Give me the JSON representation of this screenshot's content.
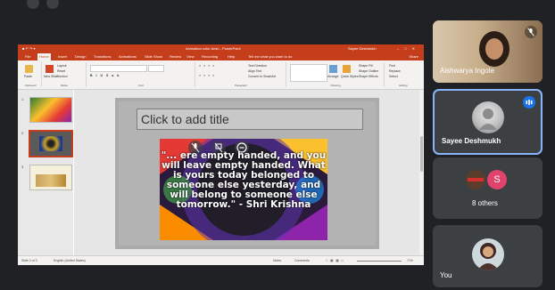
{
  "powerpoint": {
    "doc_title": "Animation color Ansh - PowerPoint",
    "user": "Sayee Deshmukh",
    "tabs": [
      "File",
      "Home",
      "Insert",
      "Design",
      "Transitions",
      "Animations",
      "Slide Show",
      "Review",
      "View",
      "Recording",
      "Help"
    ],
    "tell_me": "Tell me what you want to do",
    "share": "Share",
    "ribbon": {
      "paste": "Paste",
      "new_slide": "New Slide",
      "layout": "Layout",
      "reset": "Reset",
      "section": "Section",
      "text_direction": "Text Direction",
      "align_text": "Align Text",
      "convert_smartart": "Convert to SmartArt",
      "arrange": "Arrange",
      "quick_styles": "Quick Styles",
      "shape_fill": "Shape Fill",
      "shape_outline": "Shape Outline",
      "shape_effects": "Shape Effects",
      "find": "Find",
      "replace": "Replace",
      "select": "Select",
      "groups": [
        "Clipboard",
        "Slides",
        "Font",
        "Paragraph",
        "Drawing",
        "Editing"
      ]
    },
    "slide": {
      "title_placeholder": "Click to add title",
      "quote": "\"... ere empty handed, and you will leave empty handed. What is yours today belonged to someone else yesterday, and will belong to someone else tomorrow.\" - Shri Krishna"
    },
    "thumbnail_numbers": [
      "1",
      "2",
      "3"
    ],
    "status": {
      "slide_of": "Slide 2 of 3",
      "language": "English (United States)",
      "notes": "Notes",
      "comments": "Comments",
      "zoom": "71%"
    }
  },
  "participants": [
    {
      "name": "Aishwarya Ingole"
    },
    {
      "name": "Sayee Deshmukh"
    },
    {
      "name": "8 others",
      "avatar_letter": "S"
    },
    {
      "name": "You"
    }
  ],
  "colors": {
    "ppt_red": "#c43e1c",
    "meet_bg": "#202124",
    "tile_bg": "#3c4043",
    "active_blue": "#8ab4f8",
    "speaking_blue": "#1a73e8",
    "avatar_pink": "#e2436d"
  }
}
